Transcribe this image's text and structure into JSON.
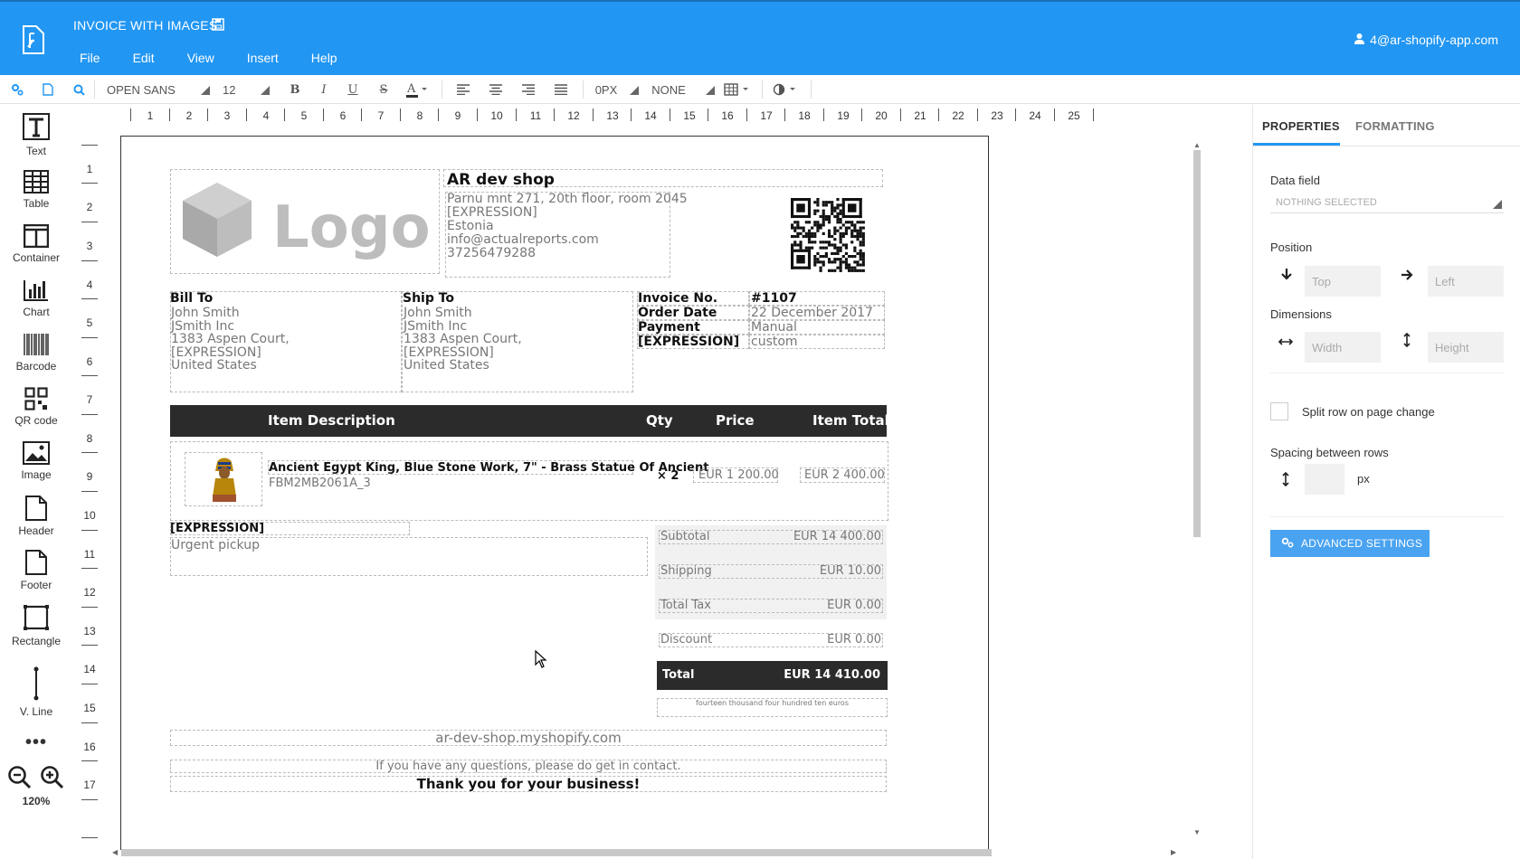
{
  "app": {
    "title": "INVOICE WITH IMAGES",
    "user": "4@ar-shopify-app.com"
  },
  "menu": [
    "File",
    "Edit",
    "View",
    "Insert",
    "Help"
  ],
  "toolbar": {
    "font": "OPEN SANS",
    "size": "12",
    "padding": "0PX",
    "border": "NONE"
  },
  "tools": [
    {
      "label": "Text",
      "icon": "text-icon"
    },
    {
      "label": "Table",
      "icon": "table-icon"
    },
    {
      "label": "Container",
      "icon": "container-icon"
    },
    {
      "label": "Chart",
      "icon": "chart-icon"
    },
    {
      "label": "Barcode",
      "icon": "barcode-icon"
    },
    {
      "label": "QR code",
      "icon": "qr-code-icon"
    },
    {
      "label": "Image",
      "icon": "image-icon"
    },
    {
      "label": "Header",
      "icon": "header-icon"
    },
    {
      "label": "Footer",
      "icon": "footer-icon"
    },
    {
      "label": "Rectangle",
      "icon": "rectangle-icon"
    },
    {
      "label": "V. Line",
      "icon": "vertical-line-icon"
    }
  ],
  "zoom": "120%",
  "more_icon": "more-icon",
  "ruler": {
    "top": [
      "1",
      "2",
      "3",
      "4",
      "5",
      "6",
      "7",
      "8",
      "9",
      "10",
      "11",
      "12",
      "13",
      "14",
      "15",
      "16",
      "17",
      "18",
      "19",
      "20",
      "21",
      "22",
      "23",
      "24",
      "25"
    ],
    "left": [
      "1",
      "2",
      "3",
      "4",
      "5",
      "6",
      "7",
      "8",
      "9",
      "10",
      "11",
      "12",
      "13",
      "14",
      "15",
      "16",
      "17"
    ]
  },
  "invoice": {
    "logo_text": "Logo",
    "shop_name": "AR dev shop",
    "shop_address": [
      "Parnu mnt 271, 20th floor, room 2045",
      "[EXPRESSION]",
      "Estonia",
      "info@actualreports.com",
      "37256479288"
    ],
    "bill_to": {
      "label": "Bill To",
      "lines": [
        "John Smith",
        "JSmith Inc",
        "1383 Aspen Court,",
        "[EXPRESSION]",
        "United States"
      ]
    },
    "ship_to": {
      "label": "Ship To",
      "lines": [
        "John Smith",
        "JSmith Inc",
        "1383 Aspen Court,",
        "[EXPRESSION]",
        "United States"
      ]
    },
    "meta": [
      {
        "label": "Invoice No.",
        "value": "#1107"
      },
      {
        "label": "Order Date",
        "value": "22 December 2017"
      },
      {
        "label": "Payment",
        "value": "Manual"
      },
      {
        "label": "[EXPRESSION]",
        "value": "custom"
      }
    ],
    "table_header": {
      "desc": "Item Description",
      "qty": "Qty",
      "price": "Price",
      "total": "Item Total"
    },
    "item": {
      "name": "Ancient Egypt King, Blue Stone Work, 7\" - Brass Statue Of Ancient",
      "sku": "FBM2MB2061A_3",
      "qty": "× 2",
      "price": "EUR 1 200.00",
      "total": "EUR 2 400.00"
    },
    "note_label": "[EXPRESSION]",
    "note_text": "Urgent pickup",
    "totals": [
      {
        "label": "Subtotal",
        "value": "EUR 14 400.00"
      },
      {
        "label": "Shipping",
        "value": "EUR 10.00"
      },
      {
        "label": "Total Tax",
        "value": "EUR 0.00"
      },
      {
        "label": "Discount",
        "value": "EUR 0.00"
      }
    ],
    "grand_total": {
      "label": "Total",
      "value": "EUR 14 410.00"
    },
    "amount_words": "fourteen thousand four hundred ten euros",
    "shop_url": "ar-dev-shop.myshopify.com",
    "questions": "If you have any questions, please do get in contact.",
    "thanks": "Thank you for your business!"
  },
  "panel": {
    "tabs": [
      "PROPERTIES",
      "FORMATTING"
    ],
    "data_field_label": "Data field",
    "data_field_value": "NOTHING SELECTED",
    "position_label": "Position",
    "top_placeholder": "Top",
    "left_placeholder": "Left",
    "dimensions_label": "Dimensions",
    "width_placeholder": "Width",
    "height_placeholder": "Height",
    "split_row_label": "Split row on page change",
    "spacing_label": "Spacing between rows",
    "spacing_unit": "px",
    "advanced_button": "ADVANCED SETTINGS"
  },
  "colors": {
    "accent": "#2196f3",
    "dark_band": "#2b2b2b",
    "button": "#4aa3f0"
  }
}
